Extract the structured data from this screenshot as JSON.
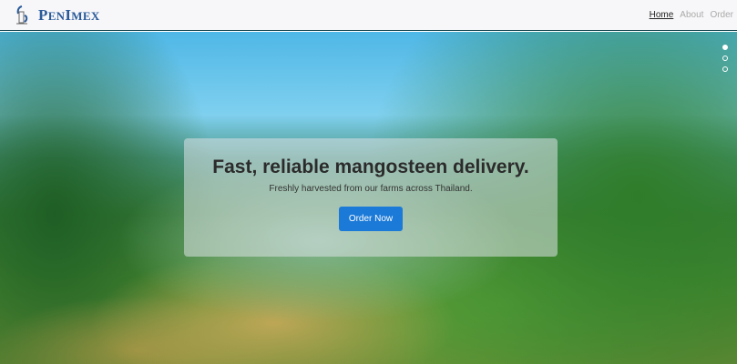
{
  "nav": {
    "brand": "PenImex",
    "brand_first": "P",
    "brand_rest1": "EN",
    "brand_i": "I",
    "brand_rest2": "MEX",
    "links": [
      {
        "label": "Home",
        "active": true
      },
      {
        "label": "About"
      },
      {
        "label": "Order"
      }
    ]
  },
  "hero": {
    "title": "Fast, reliable mangosteen delivery.",
    "subtitle": "Freshly harvested from our farms across Thailand.",
    "cta": "Order Now",
    "slides": 3,
    "active_slide": 1
  },
  "colors": {
    "brand": "#2a5a9a",
    "cta": "#1b7ad8"
  }
}
